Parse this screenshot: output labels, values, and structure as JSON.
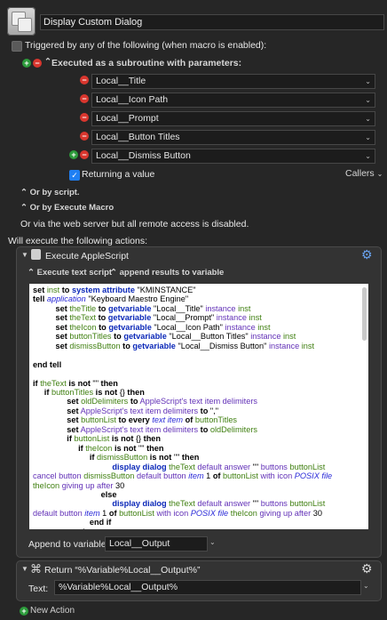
{
  "macro": {
    "name": "Display Custom Dialog"
  },
  "trigger": {
    "label": "Triggered by any of the following (when macro is enabled):",
    "subroutine_label": "Executed as a subroutine with parameters:",
    "parameters": [
      "Local__Title",
      "Local__Icon Path",
      "Local__Prompt",
      "Local__Button Titles",
      "Local__Dismiss Button"
    ],
    "returning_label": "Returning a value",
    "callers_label": "Callers",
    "or_by_script": "Or by script.",
    "or_by_execute_macro": "Or by Execute Macro",
    "web_server_note": "Or via the web server but all remote access is disabled."
  },
  "actions_header": "Will execute the following actions:",
  "applescript": {
    "title": "Execute AppleScript",
    "execute_option": "Execute text script",
    "result_option": "append results to variable",
    "append_label": "Append to variable:",
    "append_value": "Local__Output"
  },
  "return_action": {
    "title": "Return “%Variable%Local__Output%”",
    "text_label": "Text:",
    "text_value": "%Variable%Local__Output%"
  },
  "new_action": "New Action",
  "colors": {
    "background": "#262626",
    "panel": "#333333",
    "accent": "#1f7ff3",
    "add": "#2c9b3b",
    "remove": "#d9362e"
  },
  "icons": [
    "plus-circle-icon",
    "minus-circle-icon",
    "gear-icon",
    "command-icon",
    "script-icon",
    "chevron-updown-icon"
  ]
}
